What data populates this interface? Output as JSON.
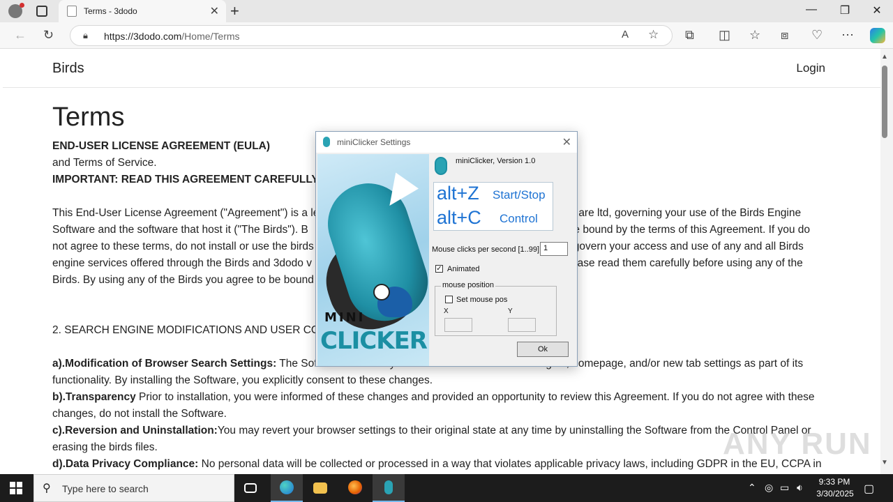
{
  "browser": {
    "tab_title": "Terms - 3dodo",
    "url_host": "https://3dodo.com",
    "url_path": "/Home/Terms"
  },
  "site": {
    "brand": "Birds",
    "login": "Login"
  },
  "content": {
    "heading": "Terms",
    "eula_title": "END-USER LICENSE AGREEMENT (EULA)",
    "eula_sub": "and Terms of Service.",
    "important": "IMPORTANT: READ THIS AGREEMENT CAREFULLY B",
    "para1_l1a": "This End-User License Agreement (\"Agreement\") is a le",
    "para1_l1b": "are ltd, governing your use of the Birds Engine",
    "para1_l2a": "Software and the software that host it (\"The Birds\"). B",
    "para1_l2b": "be bound by the terms of this Agreement. If you do",
    "para1_l3a": "not agree to these terms, do not install or use the birds",
    "para1_l3b": "govern your access and use of any and all Birds",
    "para1_l4a": "engine services offered through the Birds and 3dodo v",
    "para1_l4b": "ease read them carefully before using any of the",
    "para1_l5": "Birds. By using any of the Birds you agree to be bound",
    "section2": "2. SEARCH ENGINE MODIFICATIONS AND USER CON",
    "a_label": "a).Modification of Browser Search Settings:",
    "a_text": " The Software modifies your browser's default search engine, homepage, and/or new tab settings as part of its",
    "a_text2": "functionality. By installing the Software, you explicitly consent to these changes.",
    "b_label": "b).Transparency",
    "b_text": " Prior to installation, you were informed of these changes and provided an opportunity to review this Agreement. If you do not agree with these",
    "b_text2": "changes, do not install the Software.",
    "c_label": "c).Reversion and Uninstallation:",
    "c_text": "You may revert your browser settings to their original state at any time by uninstalling the Software from the Control Panel or",
    "c_text2": "erasing the birds files.",
    "d_label": "d).Data Privacy Compliance:",
    "d_text": " No personal data will be collected or processed in a way that violates applicable privacy laws, including GDPR in the EU, CCPA in"
  },
  "dialog": {
    "title": "miniClicker Settings",
    "version": "miniClicker, Version 1.0",
    "hotkey1": "alt+Z",
    "hotkey1_label": "Start/Stop",
    "hotkey2": "alt+C",
    "hotkey2_label": "Control",
    "clicks_label": "Mouse clicks per second [1..99]",
    "clicks_value": "1",
    "animated_label": "Animated",
    "animated_checked": true,
    "group_title": "mouse position",
    "set_pos_label": "Set mouse pos",
    "set_pos_checked": false,
    "x_label": "X",
    "y_label": "Y",
    "ok_label": "Ok",
    "banner_mini": "MINI",
    "banner_clicker": "CLICKER"
  },
  "taskbar": {
    "search_placeholder": "Type here to search",
    "time": "9:33 PM",
    "date": "3/30/2025"
  },
  "watermark": "ANY RUN"
}
